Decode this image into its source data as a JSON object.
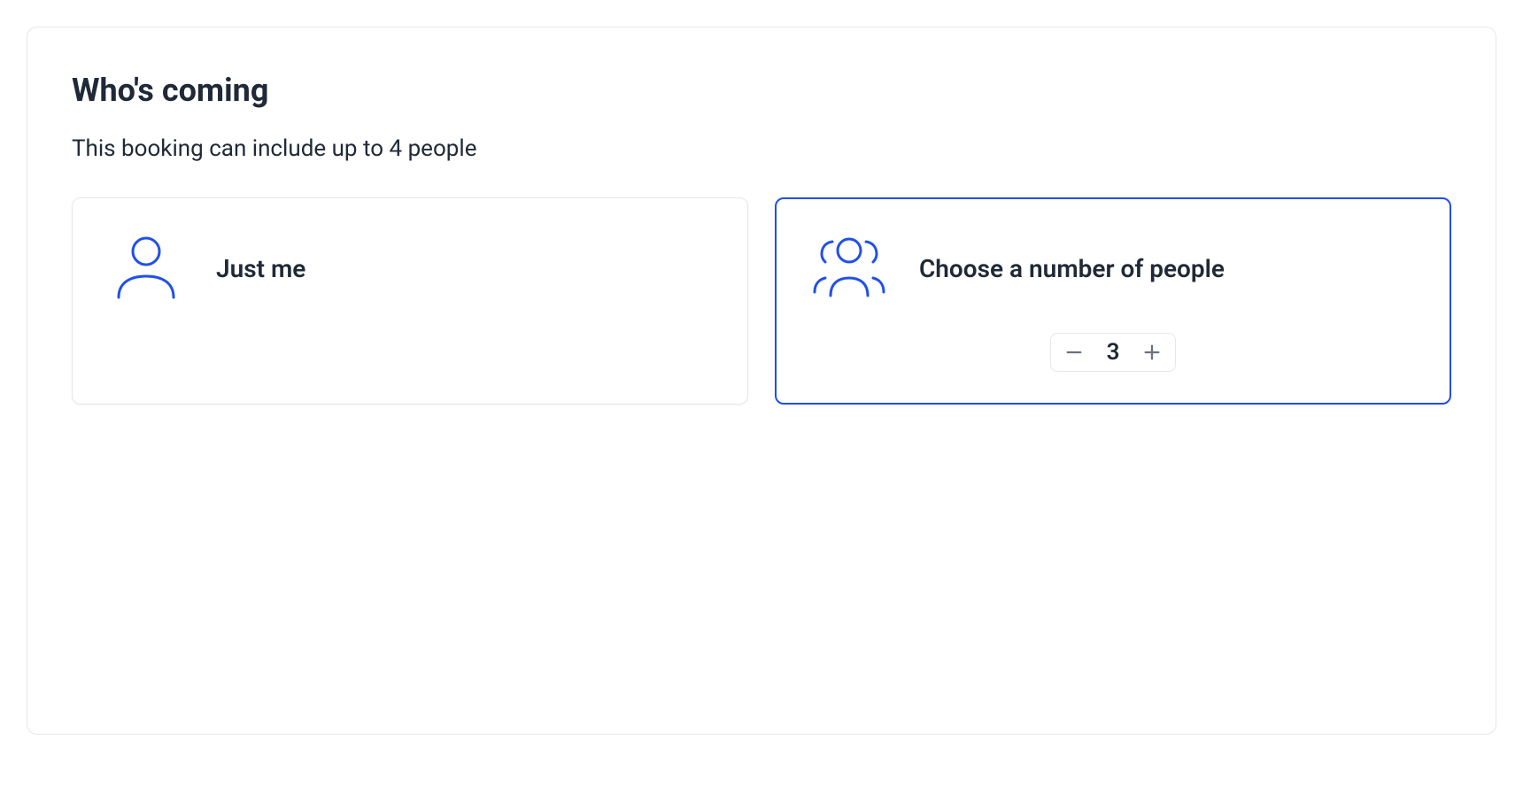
{
  "heading": "Who's coming",
  "subheading": "This booking can include up to 4 people",
  "options": {
    "just_me": {
      "label": "Just me",
      "selected": false
    },
    "choose_number": {
      "label": "Choose a number of people",
      "selected": true,
      "value": "3"
    }
  },
  "colors": {
    "accent": "#2150e8",
    "text": "#1f2937",
    "border": "#e5e7eb",
    "muted": "#6b7280"
  }
}
